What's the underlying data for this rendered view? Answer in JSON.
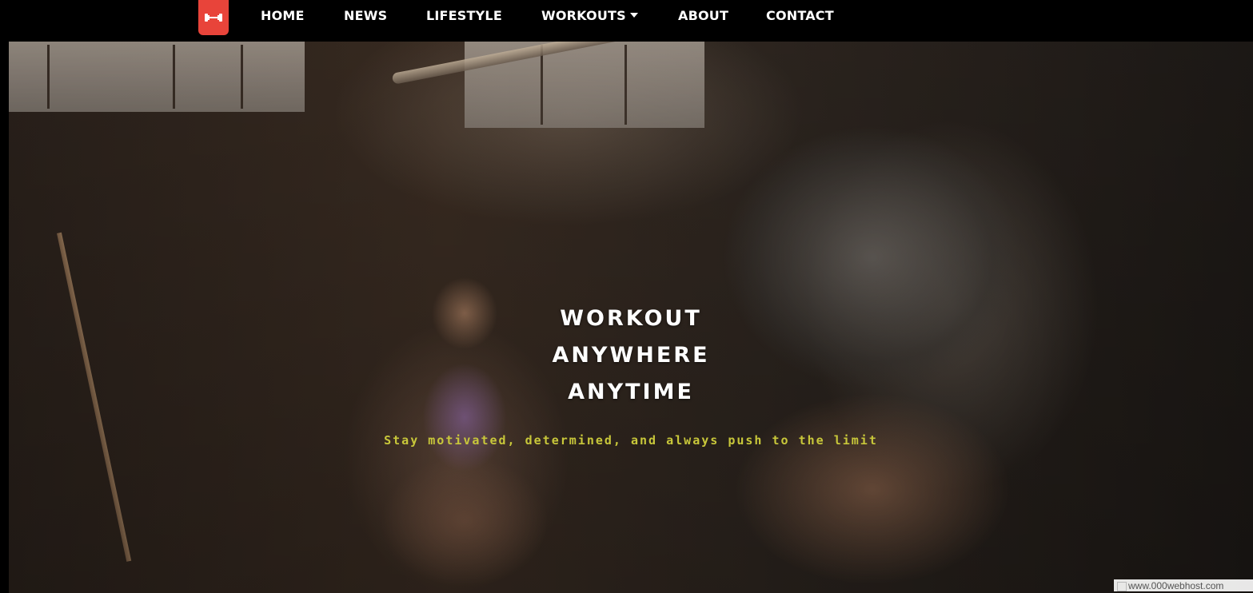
{
  "nav": {
    "logo": {
      "icon": "dumbbell-icon",
      "color": "#e8443a"
    },
    "items": [
      {
        "label": "HOME"
      },
      {
        "label": "NEWS"
      },
      {
        "label": "LIFESTYLE"
      },
      {
        "label": "WORKOUTS",
        "has_dropdown": true
      },
      {
        "label": "ABOUT"
      },
      {
        "label": "CONTACT"
      }
    ]
  },
  "hero": {
    "headline_lines": [
      "WORKOUT",
      "ANYWHERE",
      "ANYTIME"
    ],
    "tagline": "Stay motivated, determined, and always push to the limit",
    "tagline_color": "#c8c73a",
    "background_image": "gym-squat-photo"
  },
  "footer_badge": {
    "text": "www.000webhost.com"
  }
}
